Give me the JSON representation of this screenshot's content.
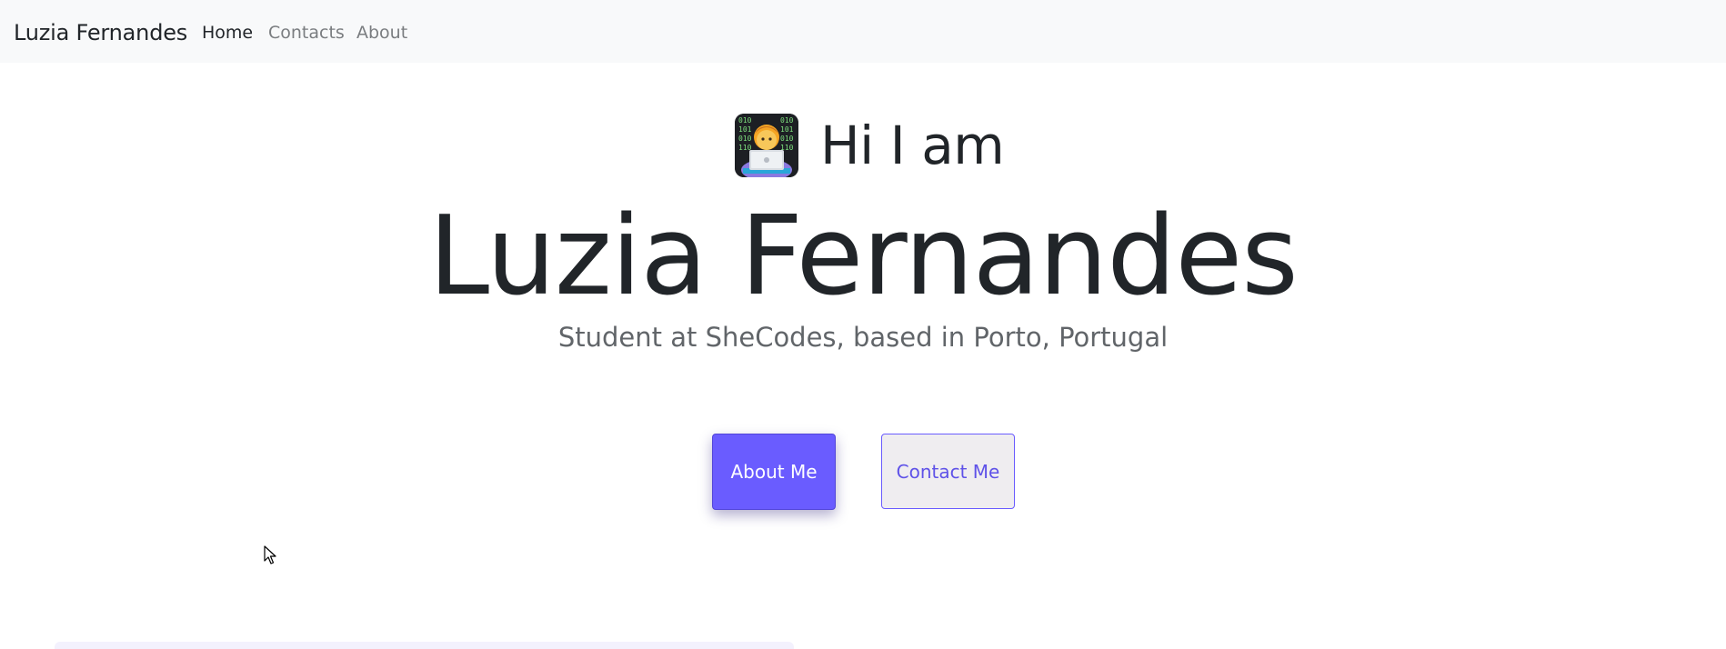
{
  "navbar": {
    "brand": "Luzia Fernandes",
    "links": [
      {
        "label": "Home",
        "active": true
      },
      {
        "label": "Contacts",
        "active": false
      },
      {
        "label": "About",
        "active": false
      }
    ]
  },
  "hero": {
    "avatar_icon": "technologist-woman-emoji",
    "greeting": "Hi I am",
    "name": "Luzia Fernandes",
    "subtitle": "Student at SheCodes, based in Porto, Portugal"
  },
  "buttons": {
    "about_label": "About Me",
    "contact_label": "Contact Me"
  },
  "colors": {
    "primary": "#6a5cff",
    "navbar_bg": "#f8f9fa",
    "text": "#212529",
    "muted": "#616569"
  }
}
